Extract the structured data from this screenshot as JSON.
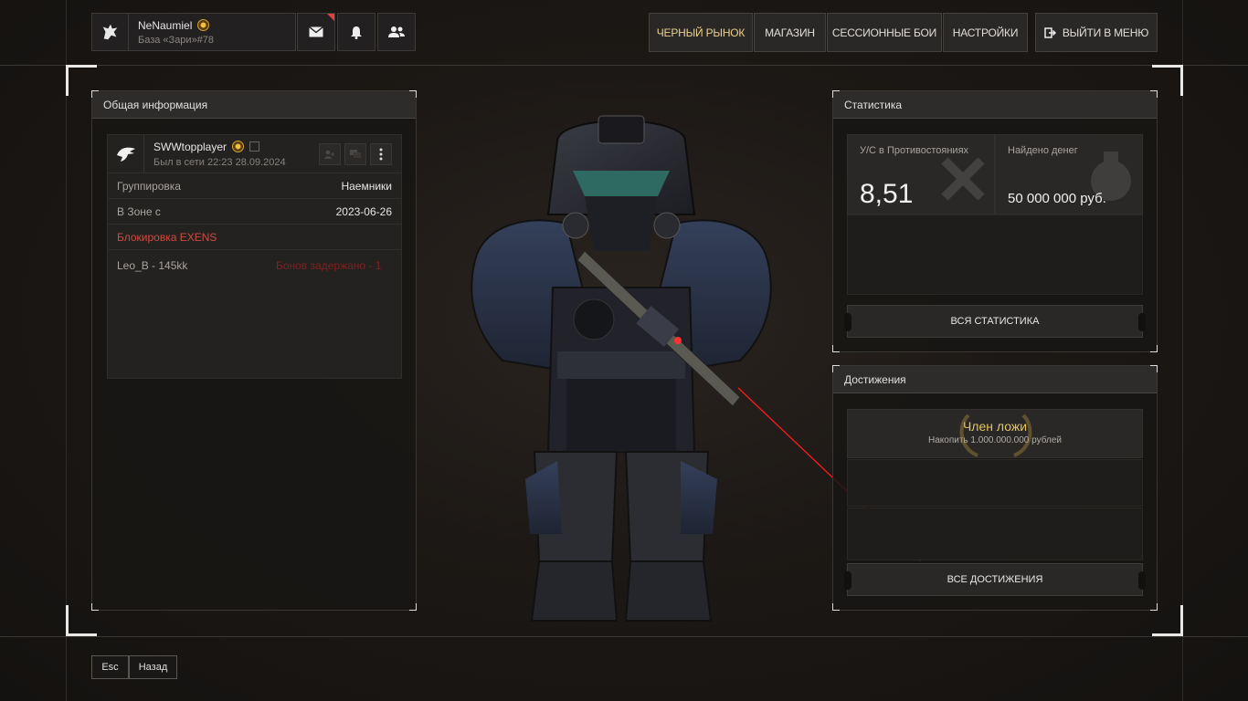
{
  "header": {
    "player": {
      "name": "NeNaumiel",
      "base": "База «Зари»#78"
    },
    "icons": [
      "mail-icon",
      "bell-icon",
      "friends-icon"
    ],
    "nav": [
      {
        "label": "ЧЕРНЫЙ РЫНОК",
        "active": true
      },
      {
        "label": "МАГАЗИН",
        "active": false
      },
      {
        "label": "СЕССИОННЫЕ БОИ",
        "active": false
      },
      {
        "label": "НАСТРОЙКИ",
        "active": false
      }
    ],
    "exit_label": "ВЫЙТИ В МЕНЮ"
  },
  "general": {
    "title": "Общая информация",
    "profile": {
      "name": "SWWtopplayer",
      "last_seen": "Был в сети 22:23 28.09.2024"
    },
    "rows": [
      {
        "label": "Группировка",
        "value": "Наемники"
      },
      {
        "label": "В Зоне с",
        "value": "2023-06-26"
      }
    ],
    "ban_text": "Блокировка EXENS",
    "note_left": "Leo_B - 145kk",
    "note_right": "Бонов задержано - 1"
  },
  "stats": {
    "title": "Статистика",
    "kd_label": "У/С в Противостояниях",
    "kd_value": "8,51",
    "money_label": "Найдено денег",
    "money_value": "50 000 000 руб.",
    "all_button": "ВСЯ СТАТИСТИКА"
  },
  "achievements": {
    "title": "Достижения",
    "item_title": "Член ложи",
    "item_sub": "Накопить 1.000.000.000 рублей",
    "all_button": "ВСЕ ДОСТИЖЕНИЯ"
  },
  "footer": {
    "key": "Esc",
    "back": "Назад"
  },
  "colors": {
    "accent_gold": "#e6c460",
    "red": "#d04a3f",
    "laser": "#ff1a1a"
  }
}
